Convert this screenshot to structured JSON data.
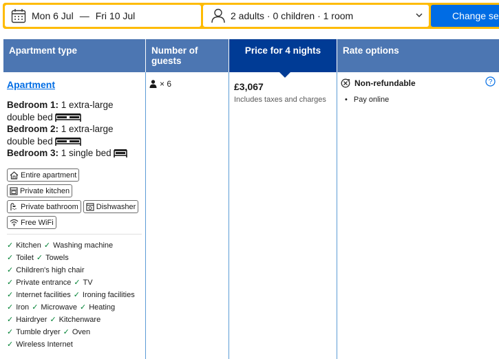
{
  "search": {
    "checkin": "Mon 6 Jul",
    "separator": "—",
    "checkout": "Fri 10 Jul",
    "guests": "2 adults · 0 children · 1 room",
    "button": "Change search"
  },
  "table": {
    "headers": {
      "type": "Apartment type",
      "guests": "Number of guests",
      "price": "Price for 4 nights",
      "rates": "Rate options"
    },
    "apartment": {
      "name": "Apartment",
      "bedrooms": [
        {
          "label": "Bedroom 1:",
          "beds": "1 extra-large double bed"
        },
        {
          "label": "Bedroom 2:",
          "beds": "1 extra-large double bed"
        },
        {
          "label": "Bedroom 3:",
          "beds": "1 single bed"
        }
      ],
      "badges": {
        "entire": "Entire apartment",
        "kitchen": "Private kitchen",
        "bathroom": "Private bathroom",
        "dishwasher": "Dishwasher",
        "wifi": "Free WiFi"
      },
      "facilities": [
        [
          "Kitchen",
          "Washing machine"
        ],
        [
          "Toilet",
          "Towels"
        ],
        [
          "Children's high chair"
        ],
        [
          "Private entrance",
          "TV"
        ],
        [
          "Internet facilities",
          "Ironing facilities"
        ],
        [
          "Iron",
          "Microwave",
          "Heating"
        ],
        [
          "Hairdryer",
          "Kitchenware"
        ],
        [
          "Tumble dryer",
          "Oven"
        ],
        [
          "Wireless Internet"
        ]
      ]
    },
    "guests_count": "× 6",
    "price": "£3,067",
    "price_note": "Includes taxes and charges",
    "rate": {
      "policy": "Non-refundable",
      "bullet": "•",
      "payment": "Pay online"
    }
  },
  "colors": {
    "accent_yellow": "#febb02",
    "button_blue": "#006ce4",
    "header_blue": "#4c76b2",
    "selected_header": "#003b95",
    "check_green": "#008234"
  }
}
